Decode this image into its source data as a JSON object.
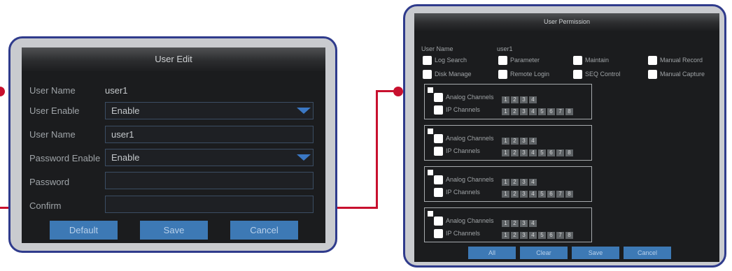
{
  "user_edit": {
    "title": "User Edit",
    "username_label": "User Name",
    "username_value": "user1",
    "enable_label": "User Enable",
    "enable_value": "Enable",
    "username_field_label": "User Name",
    "username_field_value": "user1",
    "password_enable_label": "Password Enable",
    "password_enable_value": "Enable",
    "password_label": "Password",
    "password_value": "",
    "confirm_label": "Confirm",
    "confirm_value": "",
    "buttons": {
      "default": "Default",
      "save": "Save",
      "cancel": "Cancel"
    }
  },
  "permission": {
    "title": "User Permission",
    "username_label": "User Name",
    "username_value": "user1",
    "options": [
      "Log Search",
      "Parameter",
      "Maintain",
      "Manual Record",
      "Disk Manage",
      "Remote Login",
      "SEQ Control",
      "Manual Capture"
    ],
    "groups": [
      {
        "analog_label": "Analog Channels",
        "ip_label": "IP Channels",
        "analog": [
          "1",
          "2",
          "3",
          "4"
        ],
        "ip": [
          "1",
          "2",
          "3",
          "4",
          "5",
          "6",
          "7",
          "8"
        ]
      },
      {
        "analog_label": "Analog Channels",
        "ip_label": "IP Channels",
        "analog": [
          "1",
          "2",
          "3",
          "4"
        ],
        "ip": [
          "1",
          "2",
          "3",
          "4",
          "5",
          "6",
          "7",
          "8"
        ]
      },
      {
        "analog_label": "Analog Channels",
        "ip_label": "IP Channels",
        "analog": [
          "1",
          "2",
          "3",
          "4"
        ],
        "ip": [
          "1",
          "2",
          "3",
          "4",
          "5",
          "6",
          "7",
          "8"
        ]
      },
      {
        "analog_label": "Analog Channels",
        "ip_label": "IP Channels",
        "analog": [
          "1",
          "2",
          "3",
          "4"
        ],
        "ip": [
          "1",
          "2",
          "3",
          "4",
          "5",
          "6",
          "7",
          "8"
        ]
      }
    ],
    "buttons": {
      "all": "All",
      "clear": "Clear",
      "save": "Save",
      "cancel": "Cancel"
    }
  },
  "colors": {
    "callout": "#c8102e",
    "frame_border": "#2f3b8c",
    "button": "#3d79b5"
  }
}
